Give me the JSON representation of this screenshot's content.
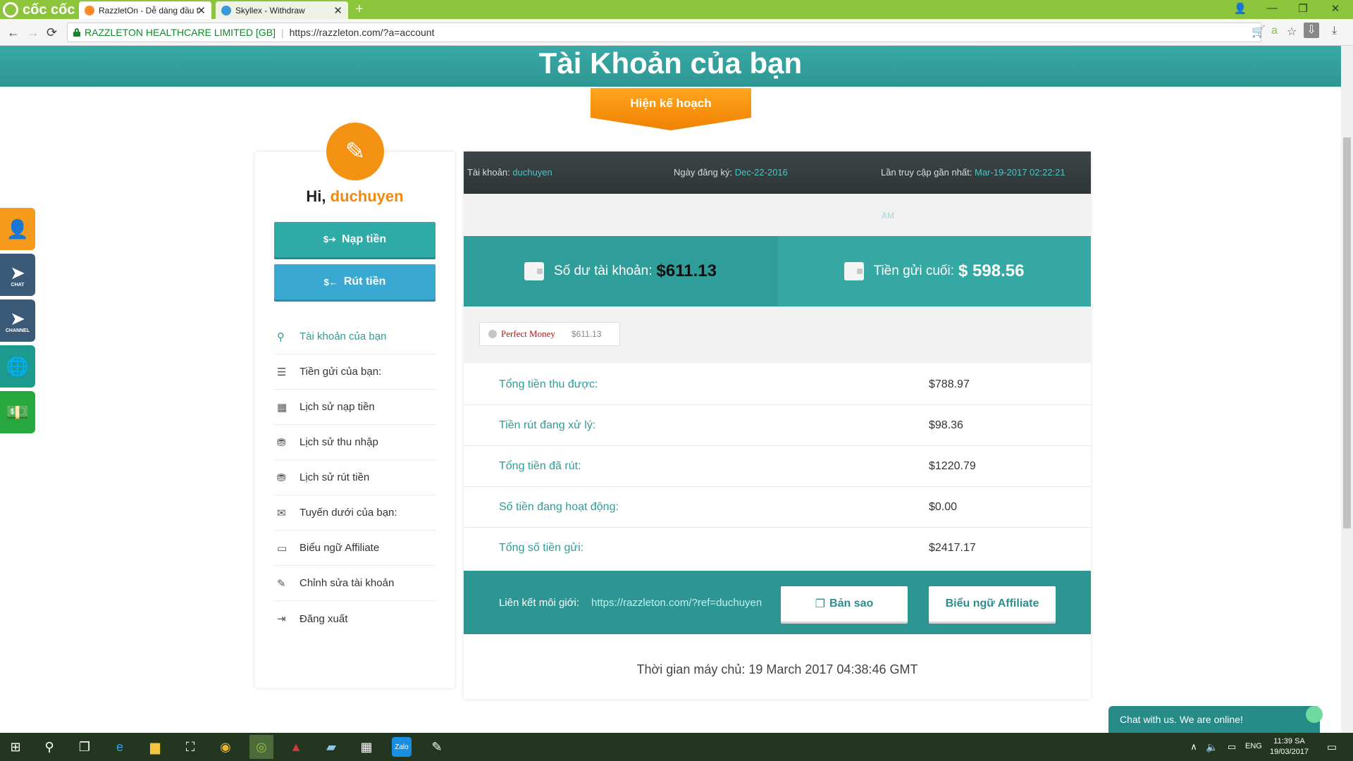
{
  "browser": {
    "brand": "cốc cốc",
    "tabs": [
      {
        "title": "RazzletOn - Dễ dàng đầu t"
      },
      {
        "title": "Skyllex - Withdraw"
      }
    ],
    "cert_name": "RAZZLETON HEALTHCARE LIMITED [GB]",
    "url": "https://razzleton.com/?a=account"
  },
  "hero": {
    "title": "Tài Khoản của bạn",
    "plan_button": "Hiện kế hoạch"
  },
  "sidebar": {
    "greeting_prefix": "Hi,",
    "username": "duchuyen",
    "deposit_label": "Nạp tiền",
    "withdraw_label": "Rút tiền",
    "menu": [
      {
        "label": "Tài khoản của bạn",
        "icon": "user-icon"
      },
      {
        "label": "Tiền gửi của bạn:",
        "icon": "database-icon"
      },
      {
        "label": "Lịch sử nạp tiền",
        "icon": "calendar-icon"
      },
      {
        "label": "Lịch sử thu nhập",
        "icon": "coins-icon"
      },
      {
        "label": "Lịch sử rút tiền",
        "icon": "coins-icon"
      },
      {
        "label": "Tuyến dưới của bạn:",
        "icon": "envelope-icon"
      },
      {
        "label": "Biểu ngữ Affiliate",
        "icon": "window-icon"
      },
      {
        "label": "Chỉnh sửa tài khoản",
        "icon": "edit-icon"
      },
      {
        "label": "Đăng xuất",
        "icon": "logout-icon"
      }
    ]
  },
  "account": {
    "account_label": "Tài khoản:",
    "account_value": "duchuyen",
    "registered_label": "Ngày đăng ký:",
    "registered_value": "Dec-22-2016",
    "last_access_label": "Lần truy cập gần nhất:",
    "last_access_value": "Mar-19-2017 02:22:21",
    "last_access_suffix": "AM"
  },
  "balances": {
    "balance_label": "Số dư tài khoản:",
    "balance_value": "$611.13",
    "last_deposit_label": "Tiền gửi cuối:",
    "last_deposit_value": "$ 598.56"
  },
  "processor": {
    "name": "Perfect Money",
    "amount": "$611.13"
  },
  "stats": [
    {
      "label": "Tổng tiền thu được:",
      "value": "$788.97"
    },
    {
      "label": "Tiền rút đang xử lý:",
      "value": "$98.36"
    },
    {
      "label": "Tổng tiền đã rút:",
      "value": "$1220.79"
    },
    {
      "label": "Số tiền đang hoạt động:",
      "value": "$0.00"
    },
    {
      "label": "Tổng số tiền gửi:",
      "value": "$2417.17"
    }
  ],
  "referral": {
    "label": "Liên kết môi giới:",
    "link": "https://razzleton.com/?ref=duchuyen",
    "copy_label": "Bản sao",
    "banner_label": "Biểu ngữ Affiliate"
  },
  "server_time": "Thời gian máy chủ: 19 March 2017 04:38:46 GMT",
  "chat_widget": "Chat with us. We are online!",
  "float_bar": {
    "chat_caption": "CHAT",
    "channel_caption": "CHANNEL"
  },
  "taskbar": {
    "lang": "ENG",
    "time": "11:39 SA",
    "date": "19/03/2017"
  },
  "colors": {
    "teal": "#2d9692",
    "orange": "#f08a0e",
    "browser_green": "#8cc43c"
  }
}
